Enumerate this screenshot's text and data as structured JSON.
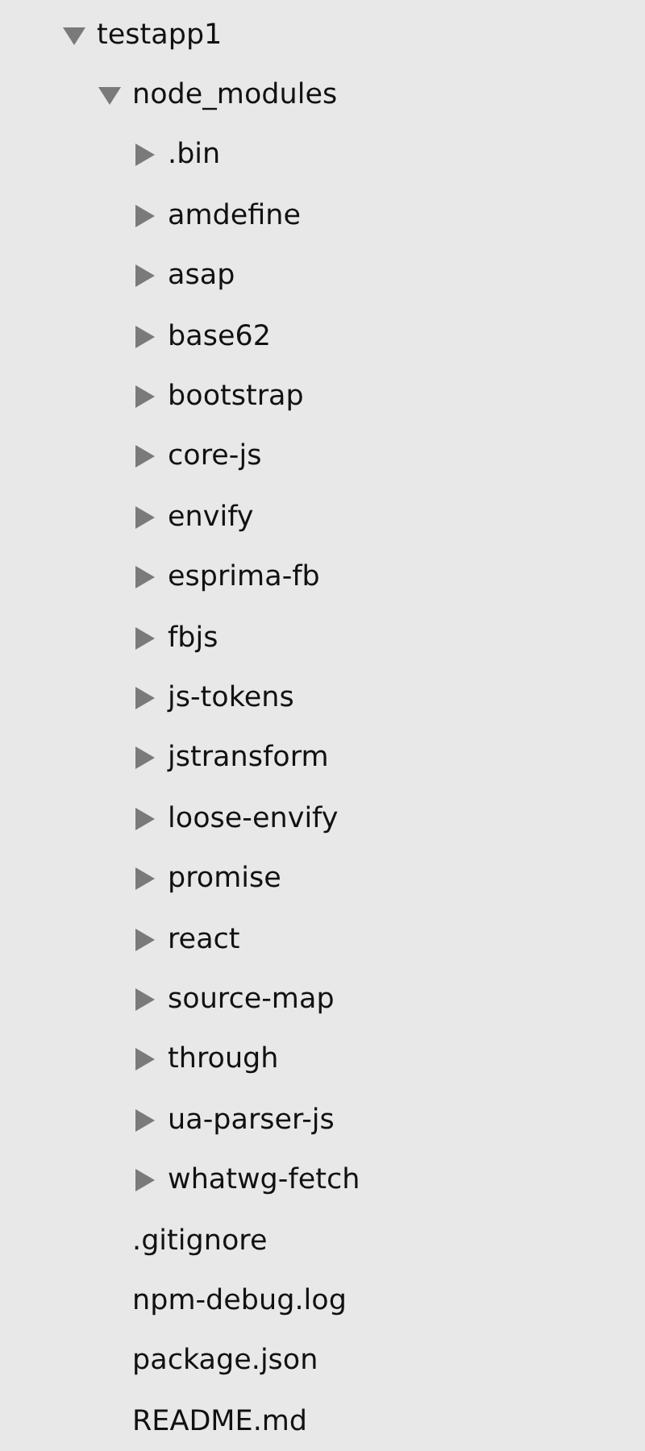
{
  "tree": [
    {
      "name": "testapp1",
      "kind": "folder",
      "expanded": true,
      "children": [
        {
          "name": "node_modules",
          "kind": "folder",
          "expanded": true,
          "children": [
            {
              "name": ".bin",
              "kind": "folder",
              "expanded": false
            },
            {
              "name": "amdefine",
              "kind": "folder",
              "expanded": false
            },
            {
              "name": "asap",
              "kind": "folder",
              "expanded": false
            },
            {
              "name": "base62",
              "kind": "folder",
              "expanded": false
            },
            {
              "name": "bootstrap",
              "kind": "folder",
              "expanded": false
            },
            {
              "name": "core-js",
              "kind": "folder",
              "expanded": false
            },
            {
              "name": "envify",
              "kind": "folder",
              "expanded": false
            },
            {
              "name": "esprima-fb",
              "kind": "folder",
              "expanded": false
            },
            {
              "name": "fbjs",
              "kind": "folder",
              "expanded": false
            },
            {
              "name": "js-tokens",
              "kind": "folder",
              "expanded": false
            },
            {
              "name": "jstransform",
              "kind": "folder",
              "expanded": false
            },
            {
              "name": "loose-envify",
              "kind": "folder",
              "expanded": false
            },
            {
              "name": "promise",
              "kind": "folder",
              "expanded": false
            },
            {
              "name": "react",
              "kind": "folder",
              "expanded": false
            },
            {
              "name": "source-map",
              "kind": "folder",
              "expanded": false
            },
            {
              "name": "through",
              "kind": "folder",
              "expanded": false
            },
            {
              "name": "ua-parser-js",
              "kind": "folder",
              "expanded": false
            },
            {
              "name": "whatwg-fetch",
              "kind": "folder",
              "expanded": false
            }
          ]
        },
        {
          "name": ".gitignore",
          "kind": "file"
        },
        {
          "name": "npm-debug.log",
          "kind": "file"
        },
        {
          "name": "package.json",
          "kind": "file"
        },
        {
          "name": "README.md",
          "kind": "file"
        }
      ]
    }
  ]
}
